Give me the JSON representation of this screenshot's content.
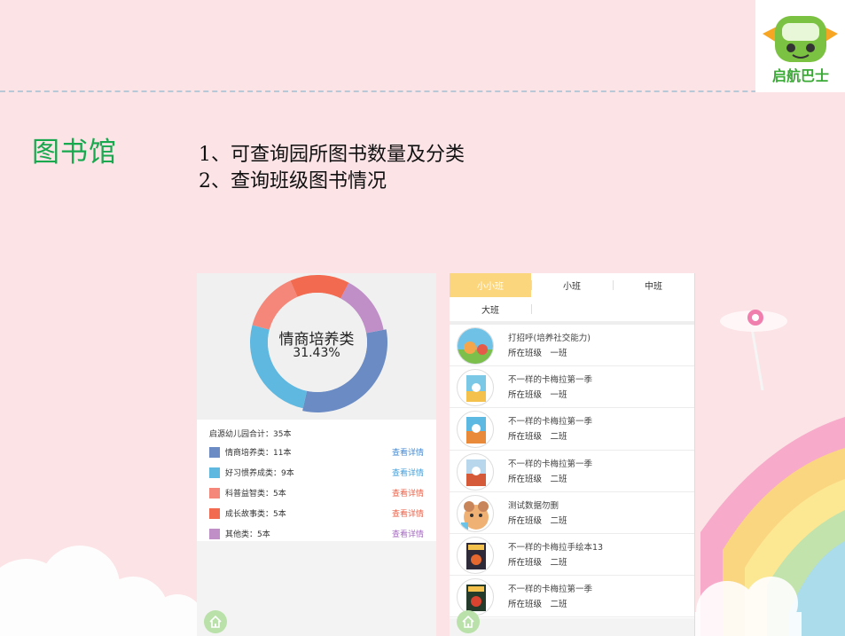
{
  "colors": {
    "background": "#fbe3e6",
    "title_green": "#18a84e",
    "tab_active": "#fbd67c",
    "detail_blue": "#4a8ad0",
    "detail_red": "#e8664f",
    "detail_purple": "#a46cbf"
  },
  "logo": {
    "text": "启航巴士"
  },
  "slide": {
    "title": "图书馆",
    "features": [
      "1、可查询园所图书数量及分类",
      "2、查询班级图书情况"
    ]
  },
  "phone1": {
    "donut": {
      "center_name": "情商培养类",
      "center_percent": "31.43%"
    },
    "total_label": "启源幼儿园合计：35本",
    "stats": [
      {
        "label": "情商培养类：11本",
        "detail": "查看详情",
        "color": "#6b8bc4",
        "detail_color": "#4a8ad0"
      },
      {
        "label": "好习惯养成类：9本",
        "detail": "查看详情",
        "color": "#5eb8e0",
        "detail_color": "#4a9fd8"
      },
      {
        "label": "科普益智类：5本",
        "detail": "查看详情",
        "color": "#f5877a",
        "detail_color": "#e8664f"
      },
      {
        "label": "成长故事类：5本",
        "detail": "查看详情",
        "color": "#f26a4f",
        "detail_color": "#e8664f"
      },
      {
        "label": "其他类：5本",
        "detail": "查看详情",
        "color": "#c08fc8",
        "detail_color": "#a46cbf"
      }
    ],
    "home_icon": "home-icon"
  },
  "chart_data": {
    "type": "pie",
    "title": "",
    "categories": [
      "情商培养类",
      "好习惯养成类",
      "科普益智类",
      "成长故事类",
      "其他类"
    ],
    "values": [
      11,
      9,
      5,
      5,
      5
    ],
    "colors": [
      "#6b8bc4",
      "#5eb8e0",
      "#f5877a",
      "#f26a4f",
      "#c08fc8"
    ],
    "donut": true,
    "highlighted": "情商培养类"
  },
  "phone2": {
    "tabs": [
      "小小班",
      "小班",
      "中班",
      "大班"
    ],
    "active_tab": "小小班",
    "books": [
      {
        "title": "打招呼(培养社交能力)",
        "class_line": "所在班级　一班"
      },
      {
        "title": "不一样的卡梅拉第一季",
        "class_line": "所在班级　一班"
      },
      {
        "title": "不一样的卡梅拉第一季",
        "class_line": "所在班级　二班"
      },
      {
        "title": "不一样的卡梅拉第一季",
        "class_line": "所在班级　二班"
      },
      {
        "title": "测试数据勿删",
        "class_line": "所在班级　二班"
      },
      {
        "title": "不一样的卡梅拉手绘本13",
        "class_line": "所在班级　二班"
      },
      {
        "title": "不一样的卡梅拉第一季",
        "class_line": "所在班级　二班"
      }
    ],
    "home_icon": "home-icon"
  }
}
